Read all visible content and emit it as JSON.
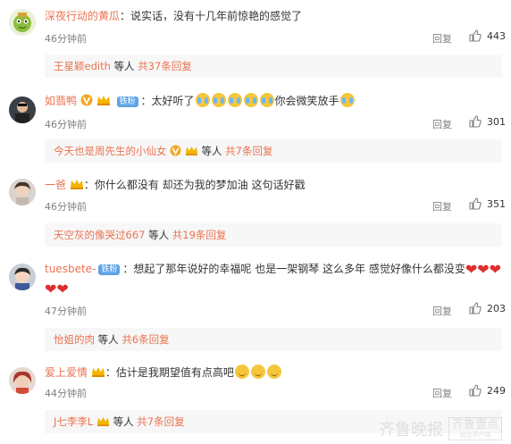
{
  "comments": [
    {
      "username": "深夜行动的黄瓜",
      "text": "：说实话，没有十几年前惊艳的感觉了",
      "time": "46分钟前",
      "reply_label": "回复",
      "likes": "443",
      "sub": {
        "user": "王星颖edith",
        "mid": " 等人 ",
        "count": "共37条回复"
      }
    },
    {
      "username": "如翡鸭",
      "fan_badge": "铁粉",
      "text": "：太好听了",
      "text2": "你会微笑放手",
      "time": "46分钟前",
      "reply_label": "回复",
      "likes": "301",
      "sub": {
        "user": "今天也是周先生的小仙女",
        "mid": " 等人 ",
        "count": "共7条回复"
      }
    },
    {
      "username": "一爸",
      "text": "：你什么都没有 却还为我的梦加油 这句话好戳",
      "time": "46分钟前",
      "reply_label": "回复",
      "likes": "351",
      "sub": {
        "user": "天空灰的像哭过667",
        "mid": " 等人 ",
        "count": "共19条回复"
      }
    },
    {
      "username": "tuesbete-",
      "fan_badge": "铁粉",
      "text": "：想起了那年说好的幸福呢 也是一架钢琴 这么多年 感觉好像什么都没变",
      "time": "47分钟前",
      "reply_label": "回复",
      "likes": "203",
      "sub": {
        "user": "怡姐的肉",
        "mid": " 等人 ",
        "count": "共6条回复"
      }
    },
    {
      "username": "爱上爱情",
      "text": "：估计是我期望值有点高吧",
      "time": "44分钟前",
      "reply_label": "回复",
      "likes": "249",
      "sub": {
        "user": "J七李李L",
        "mid": " 等人 ",
        "count": "共7条回复"
      }
    }
  ],
  "watermark": {
    "main": "齐鲁晚报",
    "box": "齐鲁壹点",
    "box_sub": "融化客户端"
  },
  "colors": {
    "username": "#eb7350",
    "fan_badge": "#5ea3e6",
    "subbar": "#f7f7f7",
    "meta": "#808080"
  },
  "icons": {
    "like": "thumbs-up-icon",
    "vip": "vip-v-icon",
    "crown": "gold-crown-icon"
  }
}
